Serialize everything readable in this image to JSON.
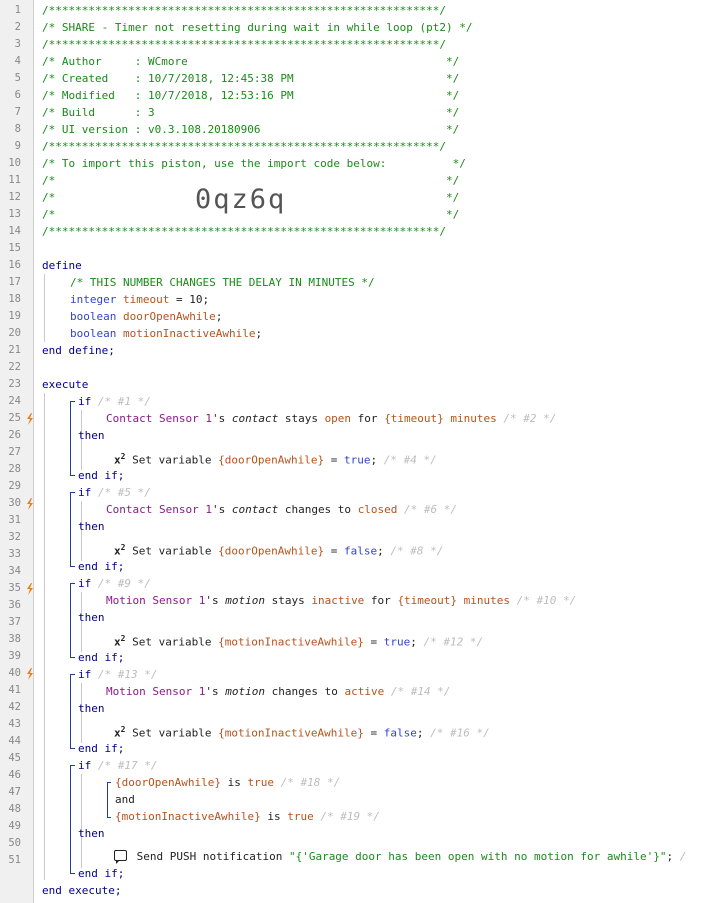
{
  "header": {
    "l1": "/***********************************************************/",
    "l2": "/* SHARE - Timer not resetting during wait in while loop (pt2) */",
    "l3": "/***********************************************************/",
    "l4": "/* Author     : WCmore                                       */",
    "l5": "/* Created    : 10/7/2018, 12:45:38 PM                       */",
    "l6": "/* Modified   : 10/7/2018, 12:53:16 PM                       */",
    "l7": "/* Build      : 3                                            */",
    "l8": "/* UI version : v0.3.108.20180906                            */",
    "l9": "/***********************************************************/",
    "l10": "/* To import this piston, use the import code below:          */",
    "l11": "/*                                                           */",
    "l12": "/*                                                           */",
    "l13": "/*                                                           */",
    "l14": "/***********************************************************/",
    "import_code": "0qz6q"
  },
  "define": {
    "kw": "define",
    "comment": "/* THIS NUMBER CHANGES THE DELAY IN MINUTES */",
    "v1_type": "integer",
    "v1_name": "timeout",
    "v1_rest": " = 10;",
    "v2_type": "boolean",
    "v2_name": "doorOpenAwhile",
    "v2_rest": ";",
    "v3_type": "boolean",
    "v3_name": "motionInactiveAwhile",
    "v3_rest": ";",
    "end": "end define;"
  },
  "execute": {
    "kw": "execute",
    "end": "end execute;",
    "if_kw": "if",
    "then_kw": "then",
    "endif_kw": "end if;",
    "and_kw": "and",
    "b1": {
      "c1": "/* #1 */",
      "dev": "Contact Sensor 1",
      "poss": "'s ",
      "attr": "contact",
      "op": " stays ",
      "val": "open",
      "tail": " for ",
      "tv": "{timeout}",
      "unit": " minutes",
      "c2": " /* #2 */",
      "act": " Set variable ",
      "var": "{doorOpenAwhile}",
      "eq": " = ",
      "bool": "true",
      "semi": ";",
      "c3": " /* #4 */"
    },
    "b2": {
      "c1": "/* #5 */",
      "dev": "Contact Sensor 1",
      "poss": "'s ",
      "attr": "contact",
      "op": " changes to ",
      "val": "closed",
      "c2": " /* #6 */",
      "act": " Set variable ",
      "var": "{doorOpenAwhile}",
      "eq": " = ",
      "bool": "false",
      "semi": ";",
      "c3": " /* #8 */"
    },
    "b3": {
      "c1": "/* #9 */",
      "dev": "Motion Sensor 1",
      "poss": "'s ",
      "attr": "motion",
      "op": " stays ",
      "val": "inactive",
      "tail": " for ",
      "tv": "{timeout}",
      "unit": " minutes",
      "c2": " /* #10 */",
      "act": " Set variable ",
      "var": "{motionInactiveAwhile}",
      "eq": " = ",
      "bool": "true",
      "semi": ";",
      "c3": " /* #12 */"
    },
    "b4": {
      "c1": "/* #13 */",
      "dev": "Motion Sensor 1",
      "poss": "'s ",
      "attr": "motion",
      "op": " changes to ",
      "val": "active",
      "c2": " /* #14 */",
      "act": " Set variable ",
      "var": "{motionInactiveAwhile}",
      "eq": " = ",
      "bool": "false",
      "semi": ";",
      "c3": " /* #16 */"
    },
    "b5": {
      "c1": "/* #17 */",
      "cond1_var": "{doorOpenAwhile}",
      "cond1_op": " is ",
      "cond1_val": "true",
      "cond1_c": " /* #18 */",
      "cond2_var": "{motionInactiveAwhile}",
      "cond2_op": " is ",
      "cond2_val": "true",
      "cond2_c": " /* #19 */",
      "act": "Send PUSH notification ",
      "msg": "\"{'Garage door has been open with no motion for awhile'}\"",
      "semi": ";",
      "c3": " /"
    }
  },
  "line_numbers": [
    "1",
    "2",
    "3",
    "4",
    "5",
    "6",
    "7",
    "8",
    "9",
    "10",
    "11",
    "12",
    "13",
    "14",
    "15",
    "16",
    "17",
    "18",
    "19",
    "20",
    "21",
    "22",
    "23",
    "24",
    "25",
    "26",
    "27",
    "28",
    "29",
    "30",
    "31",
    "32",
    "33",
    "34",
    "35",
    "36",
    "37",
    "38",
    "39",
    "40",
    "41",
    "42",
    "43",
    "44",
    "45",
    "46",
    "47",
    "48",
    "49",
    "50",
    "51"
  ],
  "colors": {
    "green": "#1a8a1a",
    "keyword": "#00008b",
    "variable": "#b5531c",
    "device": "#8a1a8a",
    "trigger": "#e67e22"
  }
}
